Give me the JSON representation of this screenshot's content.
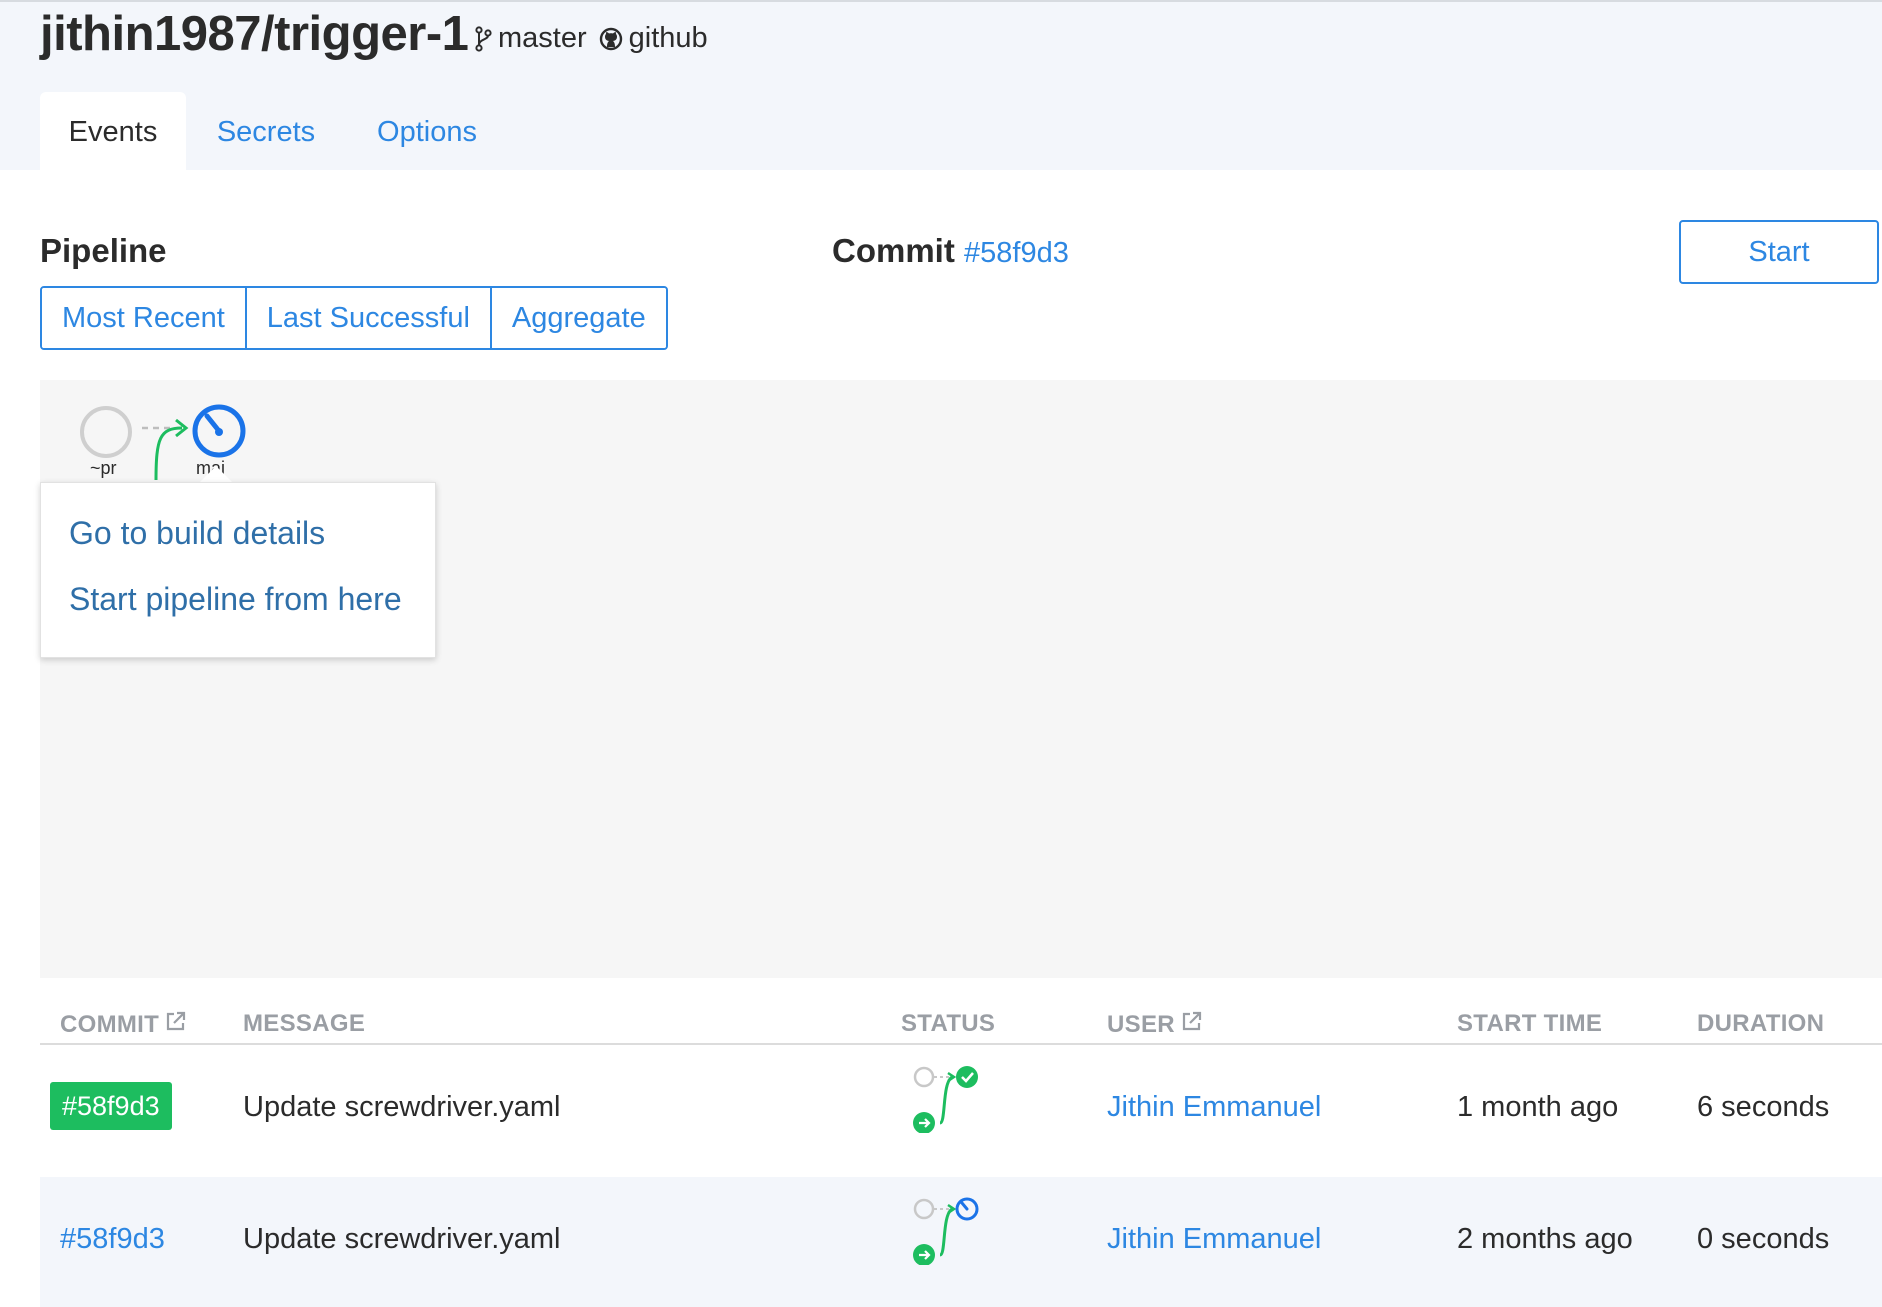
{
  "header": {
    "repo": "jithin1987/trigger-1",
    "branch": "master",
    "scm": "github",
    "tabs": [
      {
        "label": "Events",
        "active": true
      },
      {
        "label": "Secrets",
        "active": false
      },
      {
        "label": "Options",
        "active": false
      }
    ]
  },
  "pipeline": {
    "heading": "Pipeline",
    "filters": [
      "Most Recent",
      "Last Successful",
      "Aggregate"
    ],
    "commit_heading": "Commit",
    "commit_sha": "#58f9d3",
    "start_label": "Start"
  },
  "workflow": {
    "nodes": [
      {
        "label": "~pr",
        "status": "not-started"
      },
      {
        "label": "mai",
        "status": "running"
      }
    ],
    "popover": {
      "items": [
        "Go to build details",
        "Start pipeline from here"
      ]
    }
  },
  "events_table": {
    "columns": [
      "COMMIT",
      "MESSAGE",
      "STATUS",
      "USER",
      "START TIME",
      "DURATION"
    ],
    "rows": [
      {
        "commit": "#58f9d3",
        "message": "Update screwdriver.yaml",
        "status": "success",
        "user": "Jithin Emmanuel",
        "start_time": "1 month ago",
        "duration": "6 seconds",
        "selected": true
      },
      {
        "commit": "#58f9d3",
        "message": "Update screwdriver.yaml",
        "status": "running",
        "user": "Jithin Emmanuel",
        "start_time": "2 months ago",
        "duration": "0 seconds",
        "selected": false
      }
    ]
  },
  "colors": {
    "link": "#2d87e2",
    "success": "#1dbd5f",
    "running": "#1a73e8",
    "header_bg": "#f3f6fb",
    "canvas_bg": "#f6f6f6"
  },
  "icons": [
    "branch-icon",
    "github-icon",
    "external-link-icon"
  ]
}
